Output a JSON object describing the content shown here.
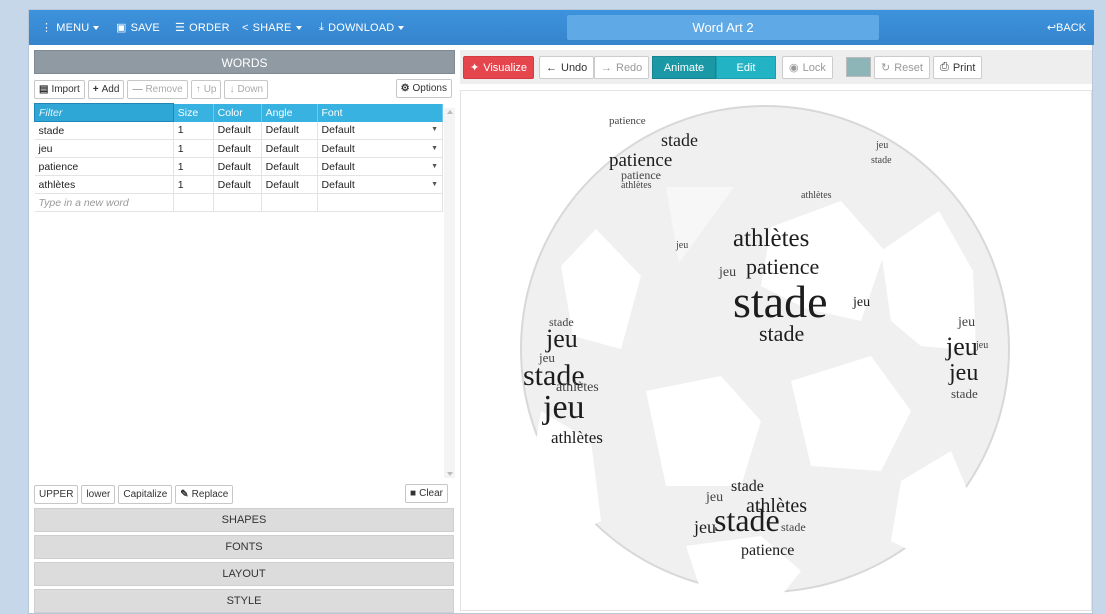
{
  "topbar": {
    "menu": "MENU",
    "save": "SAVE",
    "order": "ORDER",
    "share": "SHARE",
    "download": "DOWNLOAD",
    "title": "Word Art 2",
    "back": "BACK"
  },
  "words_panel": {
    "header": "WORDS",
    "toolbar": {
      "import": "Import",
      "add": "Add",
      "remove": "Remove",
      "up": "Up",
      "down": "Down",
      "options": "Options"
    },
    "columns": {
      "filter": "Filter",
      "size": "Size",
      "color": "Color",
      "angle": "Angle",
      "font": "Font"
    },
    "rows": [
      {
        "word": "stade",
        "size": "1",
        "color": "Default",
        "angle": "Default",
        "font": "Default"
      },
      {
        "word": "jeu",
        "size": "1",
        "color": "Default",
        "angle": "Default",
        "font": "Default"
      },
      {
        "word": "patience",
        "size": "1",
        "color": "Default",
        "angle": "Default",
        "font": "Default"
      },
      {
        "word": "athlètes",
        "size": "1",
        "color": "Default",
        "angle": "Default",
        "font": "Default"
      }
    ],
    "new_word_placeholder": "Type in a new word",
    "case_tools": {
      "upper": "UPPER",
      "lower": "lower",
      "capitalize": "Capitalize",
      "replace": "Replace",
      "clear": "Clear"
    }
  },
  "accordion": {
    "shapes": "SHAPES",
    "fonts": "FONTS",
    "layout": "LAYOUT",
    "style": "STYLE"
  },
  "right_toolbar": {
    "visualize": "Visualize",
    "undo": "Undo",
    "redo": "Redo",
    "animate": "Animate",
    "edit": "Edit",
    "lock": "Lock",
    "reset": "Reset",
    "print": "Print",
    "swatch_color": "#8db4b6"
  },
  "colors": {
    "topbar": "#3b8fd9",
    "table_header": "#38b2e0",
    "visualize": "#e5464e",
    "animate": "#1a98a6",
    "edit": "#22b4c4"
  },
  "cloud_words": [
    "athlètes",
    "patience",
    "stade",
    "jeu",
    "patience",
    "stade",
    "stade",
    "jeu",
    "stade",
    "jeu",
    "stade",
    "jeu",
    "athlètes",
    "athlètes",
    "jeu",
    "jeu",
    "stade",
    "jeu",
    "stade",
    "patience",
    "stade",
    "jeu",
    "athlètes",
    "jeu",
    "stade",
    "patience",
    "jeu",
    "jeu",
    "jeu",
    "athlètes",
    "stade",
    "jeu",
    "patience",
    "athlètes"
  ]
}
